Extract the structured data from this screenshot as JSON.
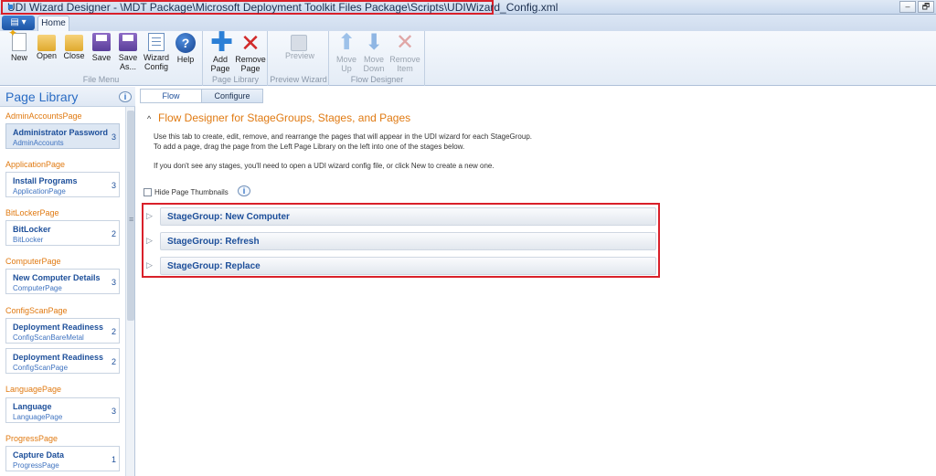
{
  "window": {
    "title": "UDI Wizard Designer -     \\MDT Package\\Microsoft Deployment Toolkit Files Package\\Scripts\\UDIWizard_Config.xml",
    "minimize_label": "–",
    "restore_label": "🗗"
  },
  "app_menu": {
    "label": "▤ ▾"
  },
  "ribbon_tabs": {
    "home": "Home"
  },
  "ribbon": {
    "file_menu": {
      "label": "File Menu",
      "new": "New",
      "open": "Open",
      "close": "Close",
      "save": "Save",
      "save_as_1": "Save",
      "save_as_2": "As...",
      "wizard_config_1": "Wizard",
      "wizard_config_2": "Config",
      "help": "Help"
    },
    "page_library": {
      "label": "Page Library",
      "add_1": "Add",
      "add_2": "Page",
      "remove_1": "Remove",
      "remove_2": "Page"
    },
    "preview_wizard": {
      "label": "Preview Wizard",
      "preview": "Preview"
    },
    "flow_designer": {
      "label": "Flow Designer",
      "up_1": "Move",
      "up_2": "Up",
      "down_1": "Move",
      "down_2": "Down",
      "rm_1": "Remove",
      "rm_2": "Item"
    }
  },
  "page_library_panel": {
    "title": "Page Library",
    "categories": [
      {
        "name": "AdminAccountsPage",
        "cards": [
          {
            "title": "Administrator Password",
            "sub": "AdminAccounts",
            "count": "3"
          }
        ]
      },
      {
        "name": "ApplicationPage",
        "cards": [
          {
            "title": "Install Programs",
            "sub": "ApplicationPage",
            "count": "3"
          }
        ]
      },
      {
        "name": "BitLockerPage",
        "cards": [
          {
            "title": "BitLocker",
            "sub": "BitLocker",
            "count": "2"
          }
        ]
      },
      {
        "name": "ComputerPage",
        "cards": [
          {
            "title": "New Computer Details",
            "sub": "ComputerPage",
            "count": "3"
          }
        ]
      },
      {
        "name": "ConfigScanPage",
        "cards": [
          {
            "title": "Deployment Readiness",
            "sub": "ConfigScanBareMetal",
            "count": "2"
          },
          {
            "title": "Deployment Readiness",
            "sub": "ConfigScanPage",
            "count": "2"
          }
        ]
      },
      {
        "name": "LanguagePage",
        "cards": [
          {
            "title": "Language",
            "sub": "LanguagePage",
            "count": "3"
          }
        ]
      },
      {
        "name": "ProgressPage",
        "cards": [
          {
            "title": "Capture Data",
            "sub": "ProgressPage",
            "count": "1"
          }
        ]
      }
    ]
  },
  "main": {
    "tabs": {
      "flow": "Flow",
      "configure": "Configure"
    },
    "heading": "Flow Designer for StageGroups, Stages, and Pages",
    "description": "Use this tab to create, edit, remove, and rearrange the pages that will appear in the UDI wizard for each StageGroup. To add a page, drag the page from the Left Page Library on the left into one of the stages below.",
    "note": "If you don't see any stages, you'll need to open a UDI wizard config file, or click New to create a new one.",
    "hide_thumbnails": "Hide Page Thumbnails",
    "stagegroups": [
      "StageGroup: New Computer",
      "StageGroup: Refresh",
      "StageGroup: Replace"
    ]
  }
}
